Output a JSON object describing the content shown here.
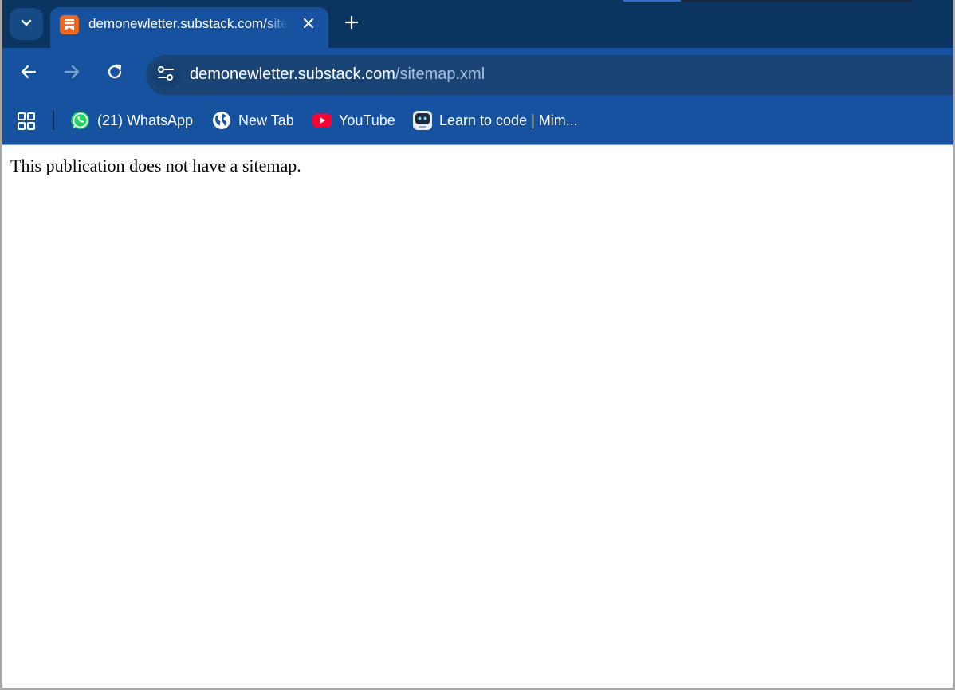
{
  "browser": {
    "tab": {
      "title": "demonewletter.substack.com/sitemap.xml",
      "favicon": "substack-icon"
    },
    "address_bar": {
      "host": "demonewletter.substack.com",
      "path": "/sitemap.xml"
    },
    "bookmarks": [
      {
        "label": "(21) WhatsApp",
        "icon": "whatsapp-icon"
      },
      {
        "label": "New Tab",
        "icon": "globe-icon"
      },
      {
        "label": "YouTube",
        "icon": "youtube-icon"
      },
      {
        "label": "Learn to code | Mim...",
        "icon": "mimo-icon"
      }
    ],
    "colors": {
      "tabstrip": "#0c3461",
      "toolbar": "#1652a0",
      "omnibox": "#1a4476",
      "substack_orange": "#f0661c",
      "whatsapp_green": "#25d366",
      "youtube_red": "#ff0033"
    }
  },
  "page": {
    "message": "This publication does not have a sitemap."
  }
}
